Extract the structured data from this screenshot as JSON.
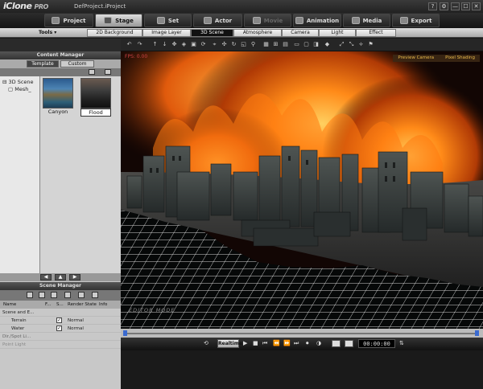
{
  "app": {
    "name": "iClone",
    "edition": "PRO",
    "project": "DefProject.iProject"
  },
  "window_controls": [
    "?",
    "⚙",
    "—",
    "☐",
    "✕"
  ],
  "main_tabs": [
    {
      "label": "Project",
      "state": "normal"
    },
    {
      "label": "Stage",
      "state": "active"
    },
    {
      "label": "Set",
      "state": "normal"
    },
    {
      "label": "Actor",
      "state": "normal"
    },
    {
      "label": "Movie",
      "state": "disabled"
    },
    {
      "label": "Animation",
      "state": "normal"
    },
    {
      "label": "Media",
      "state": "normal"
    },
    {
      "label": "Export",
      "state": "normal"
    }
  ],
  "tools_label": "Tools ▾",
  "sub_tabs": [
    {
      "label": "2D Background"
    },
    {
      "label": "Image Layer"
    },
    {
      "label": "3D Scene",
      "active": true
    },
    {
      "label": "Atmosphere"
    },
    {
      "label": "Camera"
    },
    {
      "label": "Light"
    },
    {
      "label": "Effect"
    }
  ],
  "content_manager": {
    "title": "Content Manager",
    "tabs": [
      {
        "label": "Template",
        "active": true
      },
      {
        "label": "Custom"
      }
    ],
    "tree": [
      "3D Scene",
      "Mesh_"
    ],
    "items": [
      {
        "label": "Canyon"
      },
      {
        "label": "Flood",
        "selected": true
      }
    ]
  },
  "scene_manager": {
    "title": "Scene Manager",
    "columns": [
      "Name",
      "F...",
      "S...",
      "Render State",
      "Info"
    ],
    "rows": [
      {
        "name": "Scene and E...",
        "checked": false,
        "state": ""
      },
      {
        "name": "Terrain",
        "checked": true,
        "state": "Normal"
      },
      {
        "name": "Water",
        "checked": true,
        "state": "Normal"
      },
      {
        "name": "Dir./Spot Li...",
        "checked": false,
        "state": ""
      },
      {
        "name": "Point Light",
        "checked": false,
        "state": ""
      }
    ]
  },
  "viewport": {
    "fps": "FPS: 0.00",
    "camera": "Preview Camera",
    "shading": "Pixel Shading",
    "mode": "EDITOR MODE"
  },
  "playbar": {
    "realtime": "Realtime",
    "timecode": "00:00:00"
  },
  "colors": {
    "accent": "#e8b84a",
    "fire": "#ff7a10",
    "grid": "#ffffff",
    "active_tab": "#cfcfcf"
  }
}
